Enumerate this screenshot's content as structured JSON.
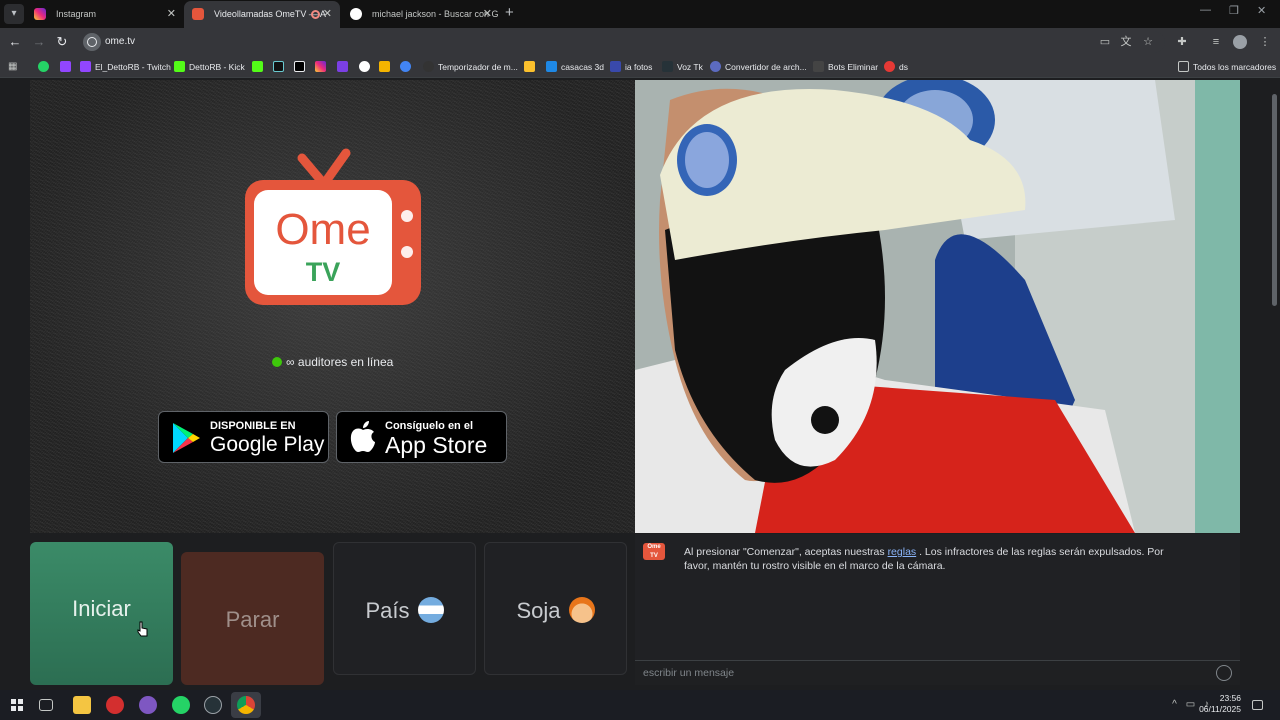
{
  "tabs": [
    {
      "title": "Instagram",
      "active": false
    },
    {
      "title": "Videollamadas OmeTV — A",
      "active": true
    },
    {
      "title": "michael jackson - Buscar con G",
      "active": false
    }
  ],
  "address_bar": {
    "url": "ome.tv"
  },
  "bookmarks": [
    {
      "label": "El_DettoRB - Twitch"
    },
    {
      "label": "DettoRB - Kick"
    },
    {
      "label": "Temporizador de m..."
    },
    {
      "label": "casacas 3d"
    },
    {
      "label": "ia fotos"
    },
    {
      "label": "Voz Tk"
    },
    {
      "label": "Convertidor de arch..."
    },
    {
      "label": "Bots Eliminar"
    },
    {
      "label": "ds"
    }
  ],
  "bookmarks_all": "Todos los marcadores",
  "logo": {
    "line1": "Ome",
    "line2": "TV"
  },
  "online_status": "∞ auditores en línea",
  "stores": {
    "google": {
      "small": "DISPONIBLE EN",
      "big": "Google Play"
    },
    "apple": {
      "small": "Consíguelo en el",
      "big": "App Store"
    }
  },
  "controls": {
    "start": "Iniciar",
    "stop": "Parar",
    "country": "País",
    "gender": "Soja"
  },
  "chat": {
    "logo_line1": "Ome",
    "logo_line2": "TV",
    "message_before": "Al presionar \"Comenzar\", aceptas nuestras",
    "message_link": "reglas",
    "message_after": ". Los infractores de las reglas serán expulsados. Por favor, mantén tu rostro visible en el marco de la cámara.",
    "input_placeholder": "escribir un mensaje"
  },
  "taskbar": {
    "time": "23:56",
    "date": "06/11/2025"
  },
  "colors": {
    "start_green": "#3b8b68",
    "stop_red": "#4d2a22",
    "ome_orange": "#e4563c",
    "online_green": "#3ec70b"
  }
}
